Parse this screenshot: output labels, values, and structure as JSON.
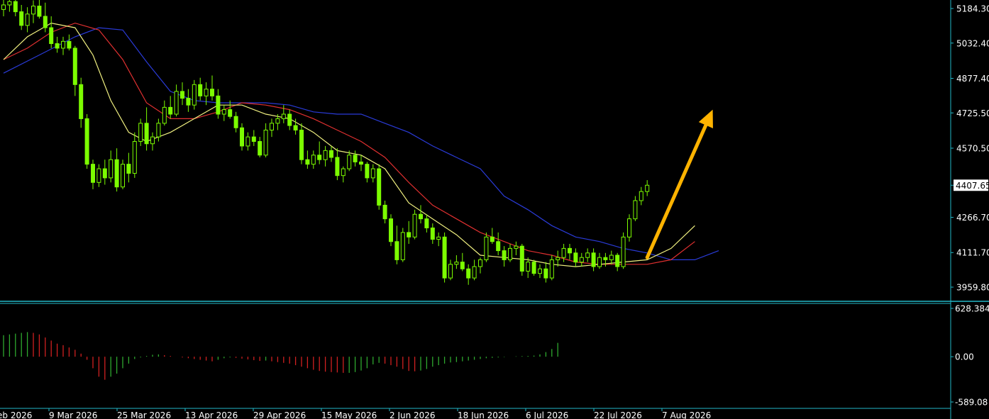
{
  "chart_data": {
    "type": "candlestick",
    "main_panel": {
      "y_ticks": [
        "5184.30",
        "5032.40",
        "4877.40",
        "4725.50",
        "4570.50",
        "4407.65",
        "4266.70",
        "4111.70",
        "3959.80"
      ],
      "ylim": [
        3920,
        5230
      ],
      "current_price": "4407.65",
      "candles": [
        [
          5180,
          5230,
          5150,
          5200
        ],
        [
          5200,
          5240,
          5170,
          5215
        ],
        [
          5215,
          5280,
          5150,
          5170
        ],
        [
          5170,
          5200,
          5090,
          5110
        ],
        [
          5110,
          5190,
          5080,
          5160
        ],
        [
          5160,
          5220,
          5120,
          5195
        ],
        [
          5195,
          5225,
          5140,
          5150
        ],
        [
          5150,
          5210,
          5080,
          5100
        ],
        [
          5100,
          5150,
          5010,
          5030
        ],
        [
          5030,
          5060,
          4990,
          5010
        ],
        [
          5010,
          5060,
          4980,
          5040
        ],
        [
          5040,
          5070,
          5000,
          5010
        ],
        [
          5010,
          5020,
          4800,
          4850
        ],
        [
          4850,
          4880,
          4660,
          4700
        ],
        [
          4700,
          4720,
          4480,
          4500
        ],
        [
          4500,
          4520,
          4390,
          4420
        ],
        [
          4420,
          4500,
          4400,
          4480
        ],
        [
          4480,
          4520,
          4410,
          4440
        ],
        [
          4440,
          4560,
          4420,
          4520
        ],
        [
          4520,
          4570,
          4380,
          4400
        ],
        [
          4400,
          4520,
          4390,
          4500
        ],
        [
          4500,
          4550,
          4420,
          4460
        ],
        [
          4460,
          4640,
          4440,
          4600
        ],
        [
          4600,
          4700,
          4580,
          4680
        ],
        [
          4680,
          4750,
          4560,
          4590
        ],
        [
          4590,
          4640,
          4560,
          4620
        ],
        [
          4620,
          4700,
          4600,
          4680
        ],
        [
          4680,
          4780,
          4670,
          4750
        ],
        [
          4750,
          4800,
          4700,
          4720
        ],
        [
          4720,
          4850,
          4710,
          4820
        ],
        [
          4820,
          4860,
          4760,
          4790
        ],
        [
          4790,
          4830,
          4730,
          4760
        ],
        [
          4760,
          4870,
          4740,
          4850
        ],
        [
          4850,
          4880,
          4780,
          4800
        ],
        [
          4800,
          4860,
          4760,
          4830
        ],
        [
          4830,
          4890,
          4780,
          4800
        ],
        [
          4800,
          4830,
          4700,
          4720
        ],
        [
          4720,
          4760,
          4690,
          4740
        ],
        [
          4740,
          4780,
          4700,
          4710
        ],
        [
          4710,
          4730,
          4640,
          4660
        ],
        [
          4660,
          4680,
          4560,
          4580
        ],
        [
          4580,
          4640,
          4560,
          4620
        ],
        [
          4620,
          4650,
          4580,
          4600
        ],
        [
          4600,
          4620,
          4530,
          4540
        ],
        [
          4540,
          4680,
          4530,
          4650
        ],
        [
          4650,
          4700,
          4620,
          4680
        ],
        [
          4680,
          4720,
          4650,
          4700
        ],
        [
          4700,
          4760,
          4680,
          4720
        ],
        [
          4720,
          4740,
          4650,
          4670
        ],
        [
          4670,
          4700,
          4630,
          4650
        ],
        [
          4650,
          4680,
          4500,
          4520
        ],
        [
          4520,
          4560,
          4480,
          4500
        ],
        [
          4500,
          4560,
          4480,
          4540
        ],
        [
          4540,
          4600,
          4500,
          4520
        ],
        [
          4520,
          4580,
          4490,
          4560
        ],
        [
          4560,
          4580,
          4510,
          4530
        ],
        [
          4530,
          4570,
          4430,
          4450
        ],
        [
          4450,
          4490,
          4420,
          4480
        ],
        [
          4480,
          4560,
          4470,
          4540
        ],
        [
          4540,
          4560,
          4490,
          4510
        ],
        [
          4510,
          4540,
          4470,
          4500
        ],
        [
          4500,
          4510,
          4420,
          4440
        ],
        [
          4440,
          4500,
          4420,
          4480
        ],
        [
          4480,
          4500,
          4300,
          4320
        ],
        [
          4320,
          4340,
          4240,
          4260
        ],
        [
          4260,
          4280,
          4140,
          4160
        ],
        [
          4160,
          4230,
          4060,
          4080
        ],
        [
          4080,
          4220,
          4070,
          4200
        ],
        [
          4200,
          4250,
          4150,
          4180
        ],
        [
          4180,
          4300,
          4170,
          4280
        ],
        [
          4280,
          4320,
          4240,
          4260
        ],
        [
          4260,
          4280,
          4200,
          4220
        ],
        [
          4220,
          4240,
          4150,
          4170
        ],
        [
          4170,
          4200,
          4140,
          4180
        ],
        [
          4180,
          4200,
          3980,
          4000
        ],
        [
          4000,
          4080,
          3990,
          4060
        ],
        [
          4060,
          4100,
          4040,
          4070
        ],
        [
          4070,
          4110,
          4030,
          4040
        ],
        [
          4040,
          4060,
          3970,
          4000
        ],
        [
          4000,
          4080,
          3990,
          4050
        ],
        [
          4050,
          4090,
          4020,
          4080
        ],
        [
          4080,
          4200,
          4070,
          4180
        ],
        [
          4180,
          4220,
          4150,
          4160
        ],
        [
          4160,
          4200,
          4100,
          4120
        ],
        [
          4120,
          4140,
          4050,
          4080
        ],
        [
          4080,
          4150,
          4070,
          4130
        ],
        [
          4130,
          4160,
          4100,
          4140
        ],
        [
          4140,
          4150,
          4010,
          4030
        ],
        [
          4030,
          4090,
          4000,
          4070
        ],
        [
          4070,
          4080,
          4010,
          4020
        ],
        [
          4020,
          4060,
          4000,
          4040
        ],
        [
          4040,
          4070,
          3980,
          4000
        ],
        [
          4000,
          4100,
          3990,
          4080
        ],
        [
          4080,
          4120,
          4050,
          4090
        ],
        [
          4090,
          4150,
          4070,
          4130
        ],
        [
          4130,
          4150,
          4080,
          4110
        ],
        [
          4110,
          4130,
          4050,
          4070
        ],
        [
          4070,
          4110,
          4050,
          4090
        ],
        [
          4090,
          4130,
          4070,
          4110
        ],
        [
          4110,
          4130,
          4030,
          4050
        ],
        [
          4050,
          4110,
          4040,
          4090
        ],
        [
          4090,
          4110,
          4050,
          4080
        ],
        [
          4080,
          4120,
          4060,
          4100
        ],
        [
          4100,
          4110,
          4030,
          4050
        ],
        [
          4050,
          4200,
          4040,
          4180
        ],
        [
          4180,
          4280,
          4160,
          4260
        ],
        [
          4260,
          4360,
          4250,
          4340
        ],
        [
          4340,
          4400,
          4320,
          4380
        ],
        [
          4380,
          4430,
          4360,
          4407.65
        ]
      ],
      "ma_yellow": [
        [
          0,
          4960
        ],
        [
          4,
          5060
        ],
        [
          8,
          5120
        ],
        [
          12,
          5100
        ],
        [
          15,
          4980
        ],
        [
          18,
          4780
        ],
        [
          21,
          4640
        ],
        [
          24,
          4600
        ],
        [
          28,
          4640
        ],
        [
          32,
          4700
        ],
        [
          36,
          4760
        ],
        [
          40,
          4760
        ],
        [
          44,
          4720
        ],
        [
          48,
          4700
        ],
        [
          52,
          4640
        ],
        [
          56,
          4560
        ],
        [
          60,
          4540
        ],
        [
          64,
          4480
        ],
        [
          68,
          4330
        ],
        [
          72,
          4260
        ],
        [
          76,
          4190
        ],
        [
          80,
          4100
        ],
        [
          84,
          4090
        ],
        [
          88,
          4080
        ],
        [
          92,
          4060
        ],
        [
          96,
          4050
        ],
        [
          100,
          4060
        ],
        [
          104,
          4070
        ],
        [
          108,
          4080
        ],
        [
          112,
          4130
        ],
        [
          116,
          4230
        ]
      ],
      "ma_red": [
        [
          0,
          4960
        ],
        [
          4,
          5010
        ],
        [
          8,
          5080
        ],
        [
          12,
          5120
        ],
        [
          16,
          5090
        ],
        [
          20,
          4960
        ],
        [
          24,
          4770
        ],
        [
          28,
          4700
        ],
        [
          32,
          4700
        ],
        [
          36,
          4730
        ],
        [
          40,
          4770
        ],
        [
          44,
          4760
        ],
        [
          48,
          4740
        ],
        [
          52,
          4700
        ],
        [
          56,
          4650
        ],
        [
          60,
          4600
        ],
        [
          64,
          4530
        ],
        [
          68,
          4420
        ],
        [
          72,
          4320
        ],
        [
          76,
          4260
        ],
        [
          80,
          4200
        ],
        [
          84,
          4160
        ],
        [
          88,
          4120
        ],
        [
          92,
          4100
        ],
        [
          96,
          4070
        ],
        [
          100,
          4060
        ],
        [
          104,
          4060
        ],
        [
          108,
          4060
        ],
        [
          112,
          4080
        ],
        [
          116,
          4160
        ]
      ],
      "ma_blue": [
        [
          0,
          4900
        ],
        [
          6,
          4980
        ],
        [
          12,
          5060
        ],
        [
          16,
          5100
        ],
        [
          20,
          5090
        ],
        [
          24,
          4950
        ],
        [
          28,
          4820
        ],
        [
          32,
          4780
        ],
        [
          36,
          4770
        ],
        [
          40,
          4770
        ],
        [
          44,
          4770
        ],
        [
          48,
          4760
        ],
        [
          52,
          4730
        ],
        [
          56,
          4720
        ],
        [
          60,
          4720
        ],
        [
          64,
          4680
        ],
        [
          68,
          4640
        ],
        [
          72,
          4580
        ],
        [
          76,
          4530
        ],
        [
          80,
          4480
        ],
        [
          84,
          4360
        ],
        [
          88,
          4300
        ],
        [
          92,
          4230
        ],
        [
          96,
          4180
        ],
        [
          100,
          4160
        ],
        [
          104,
          4130
        ],
        [
          108,
          4110
        ],
        [
          112,
          4080
        ],
        [
          116,
          4080
        ],
        [
          120,
          4120
        ]
      ],
      "arrow": {
        "from": [
          108,
          4090
        ],
        "to": [
          119,
          4740
        ],
        "color": "#ffb300"
      }
    },
    "oscillator": {
      "y_ticks": [
        "628.384",
        "0.00",
        "-589.08"
      ],
      "ylim": [
        -589.08,
        628.384
      ],
      "values": [
        280,
        290,
        300,
        310,
        320,
        310,
        290,
        250,
        210,
        170,
        150,
        120,
        90,
        40,
        -40,
        -150,
        -260,
        -300,
        -260,
        -220,
        -150,
        -90,
        -30,
        -10,
        10,
        25,
        30,
        20,
        10,
        0,
        -10,
        -20,
        -30,
        -40,
        -50,
        -60,
        -40,
        -20,
        -10,
        -15,
        -25,
        -35,
        -45,
        -55,
        -50,
        -60,
        -70,
        -80,
        -90,
        -110,
        -130,
        -150,
        -170,
        -185,
        -195,
        -200,
        -205,
        -210,
        -210,
        -200,
        -180,
        -150,
        -100,
        -80,
        -90,
        -110,
        -130,
        -160,
        -185,
        -190,
        -180,
        -160,
        -130,
        -110,
        -90,
        -75,
        -70,
        -60,
        -50,
        -40,
        -30,
        -20,
        -15,
        -10,
        -5,
        0,
        5,
        8,
        10,
        15,
        30,
        60,
        100,
        180
      ]
    },
    "x_labels": [
      "eb 2026",
      "9 Mar 2026",
      "25 Mar 2026",
      "13 Apr 2026",
      "29 Apr 2026",
      "15 May 2026",
      "2 Jun 2026",
      "18 Jun 2026",
      "6 Jul 2026",
      "22 Jul 2026",
      "7 Aug 2026"
    ],
    "colors": {
      "background": "#000000",
      "frame": "#22b8c8",
      "bull_candle": "#7cfc00",
      "ma_yellow": "#f0f080",
      "ma_red": "#e03030",
      "ma_blue": "#2a3bd8",
      "osc_up": "#2ea82e",
      "osc_down": "#d02020",
      "price_box": "#ffffff"
    }
  }
}
